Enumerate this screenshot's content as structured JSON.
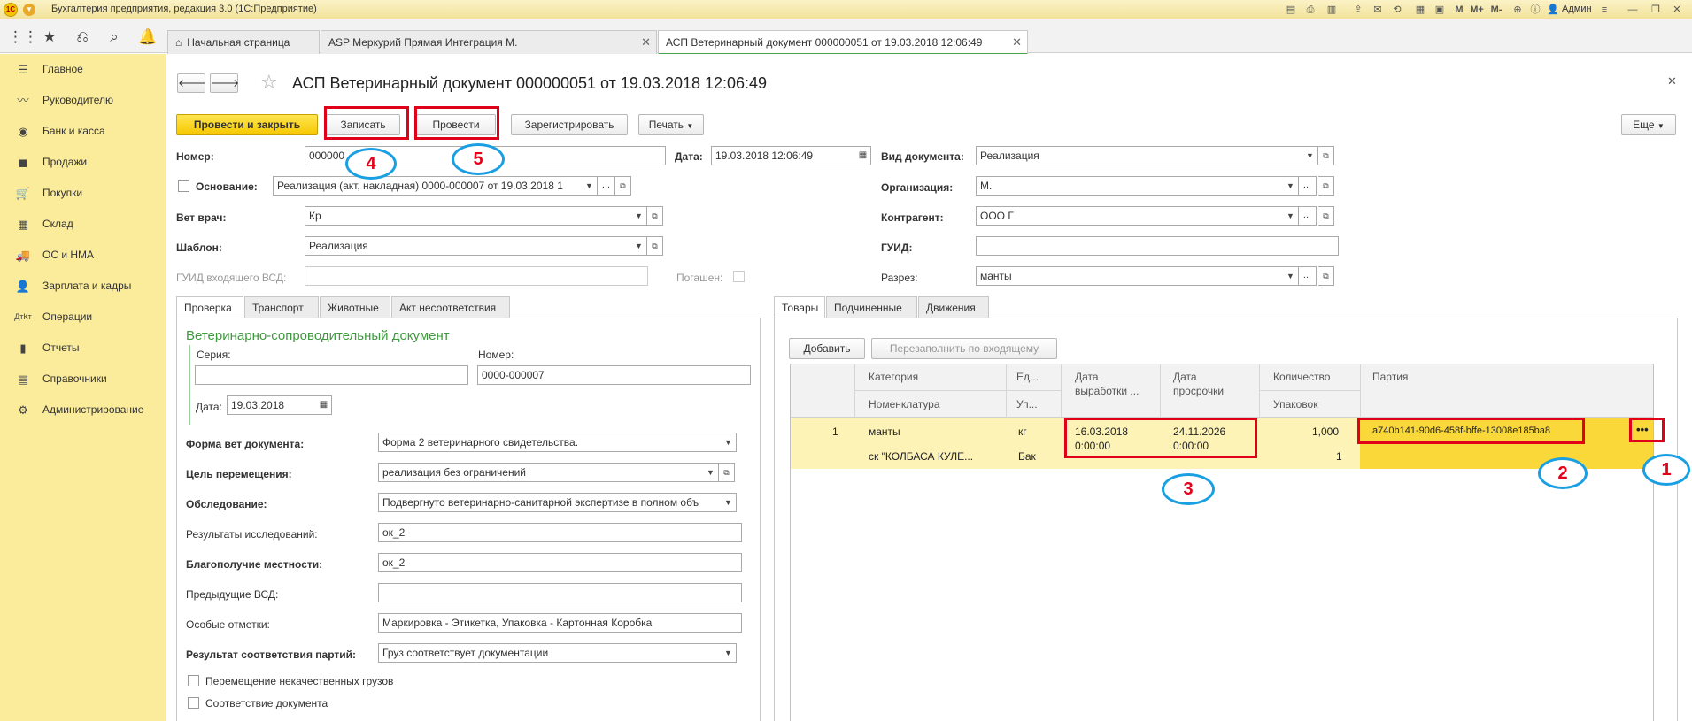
{
  "window": {
    "title": "Бухгалтерия предприятия, редакция 3.0  (1С:Предприятие)",
    "user": "Админ"
  },
  "tabs": [
    {
      "label": "Начальная страница"
    },
    {
      "label": "ASP Меркурий Прямая Интеграция М."
    },
    {
      "label": "АСП Ветеринарный документ 000000051 от 19.03.2018 12:06:49"
    }
  ],
  "sidebar": {
    "items": [
      {
        "label": "Главное",
        "icon": "menu-icon"
      },
      {
        "label": "Руководителю",
        "icon": "chart-line-icon"
      },
      {
        "label": "Банк и касса",
        "icon": "coin-icon"
      },
      {
        "label": "Продажи",
        "icon": "bag-icon"
      },
      {
        "label": "Покупки",
        "icon": "cart-icon"
      },
      {
        "label": "Склад",
        "icon": "warehouse-icon"
      },
      {
        "label": "ОС и НМА",
        "icon": "truck-icon"
      },
      {
        "label": "Зарплата и кадры",
        "icon": "person-icon"
      },
      {
        "label": "Операции",
        "icon": "dt-kt-icon"
      },
      {
        "label": "Отчеты",
        "icon": "bar-chart-icon"
      },
      {
        "label": "Справочники",
        "icon": "book-icon"
      },
      {
        "label": "Администрирование",
        "icon": "gear-icon"
      }
    ]
  },
  "doc": {
    "title": "АСП Ветеринарный документ 000000051 от 19.03.2018 12:06:49"
  },
  "toolbar": {
    "post_close": "Провести и закрыть",
    "save": "Записать",
    "post": "Провести",
    "register": "Зарегистрировать",
    "print": "Печать",
    "more": "Еще"
  },
  "form": {
    "number_label": "Номер:",
    "number_value": "000000",
    "date_label": "Дата:",
    "date_value": "19.03.2018 12:06:49",
    "doc_type_label": "Вид документа:",
    "doc_type_value": "Реализация",
    "basis_label": "Основание:",
    "basis_value": "Реализация (акт, накладная) 0000-000007 от 19.03.2018 1",
    "org_label": "Организация:",
    "org_value": "М.",
    "vet_label": "Вет врач:",
    "vet_value": "Кр",
    "counterparty_label": "Контрагент:",
    "counterparty_value": "ООО  Г",
    "template_label": "Шаблон:",
    "template_value": "Реализация",
    "guid_label": "ГУИД:",
    "guid_value": "",
    "guid_in_label": "ГУИД входящего ВСД:",
    "guid_in_value": "",
    "repaid_label": "Погашен:",
    "section_label": "Разрез:",
    "section_value": "манты"
  },
  "left_tabs": [
    "Проверка",
    "Транспорт",
    "Животные",
    "Акт несоответствия"
  ],
  "left": {
    "group_title": "Ветеринарно-сопроводительный документ",
    "series_label": "Серия:",
    "series_value": "",
    "number_label": "Номер:",
    "number_value": "0000-000007",
    "date_label": "Дата:",
    "date_value": "19.03.2018",
    "rows": [
      {
        "label": "Форма вет документа:",
        "value": "Форма 2 ветеринарного свидетельства.",
        "bold": true,
        "ctl": "dd"
      },
      {
        "label": "Цель перемещения:",
        "value": "реализация без ограничений",
        "bold": true,
        "ctl": "ddopen"
      },
      {
        "label": "Обследование:",
        "value": "Подвергнуто ветеринарно-санитарной экспертизе в полном объ",
        "bold": true,
        "ctl": "dd"
      },
      {
        "label": "Результаты исследований:",
        "value": "ок_2",
        "bold": false,
        "ctl": "none"
      },
      {
        "label": "Благополучие местности:",
        "value": "ок_2",
        "bold": true,
        "ctl": "none"
      },
      {
        "label": "Предыдущие ВСД:",
        "value": "",
        "bold": false,
        "ctl": "none"
      },
      {
        "label": "Особые отметки:",
        "value": "Маркировка - Этикетка, Упаковка - Картонная Коробка",
        "bold": false,
        "ctl": "none"
      },
      {
        "label": "Результат соответствия партий:",
        "value": "Груз соответствует документации",
        "bold": true,
        "ctl": "dd"
      }
    ],
    "check1": "Перемещение некачественных грузов",
    "check2": "Соответствие документа"
  },
  "right_tabs": [
    "Товары",
    "Подчиненные",
    "Движения"
  ],
  "goods": {
    "add": "Добавить",
    "refill": "Перезаполнить по входящему",
    "headers": {
      "category": "Категория",
      "nomenclature": "Номенклатура",
      "unit_top": "Ед...",
      "unit_bottom": "Уп...",
      "prod_date_1": "Дата",
      "prod_date_2": "выработки ...",
      "exp_date_1": "Дата",
      "exp_date_2": "просрочки",
      "qty": "Количество",
      "pack": "Упаковок",
      "batch": "Партия"
    },
    "row": {
      "n": "1",
      "category": "манты",
      "nomenclature": "ск \"КОЛБАСА КУЛЕ...",
      "unit": "кг",
      "pack_unit": "Бак",
      "prod_date": "16.03.2018",
      "prod_time": "0:00:00",
      "exp_date": "24.11.2026",
      "exp_time": "0:00:00",
      "qty": "1,000",
      "packs": "1",
      "batch": "a740b141-90d6-458f-bffe-13008e185ba8",
      "more": "•••"
    }
  },
  "annotations": [
    "1",
    "2",
    "3",
    "4",
    "5"
  ],
  "colors": {
    "sidebar": "#fbec9c",
    "accent_yellow": "#f6c800",
    "highlight_row": "#fdf3b6",
    "annot_red": "#e0001a",
    "annot_blue": "#1a9fe2"
  }
}
